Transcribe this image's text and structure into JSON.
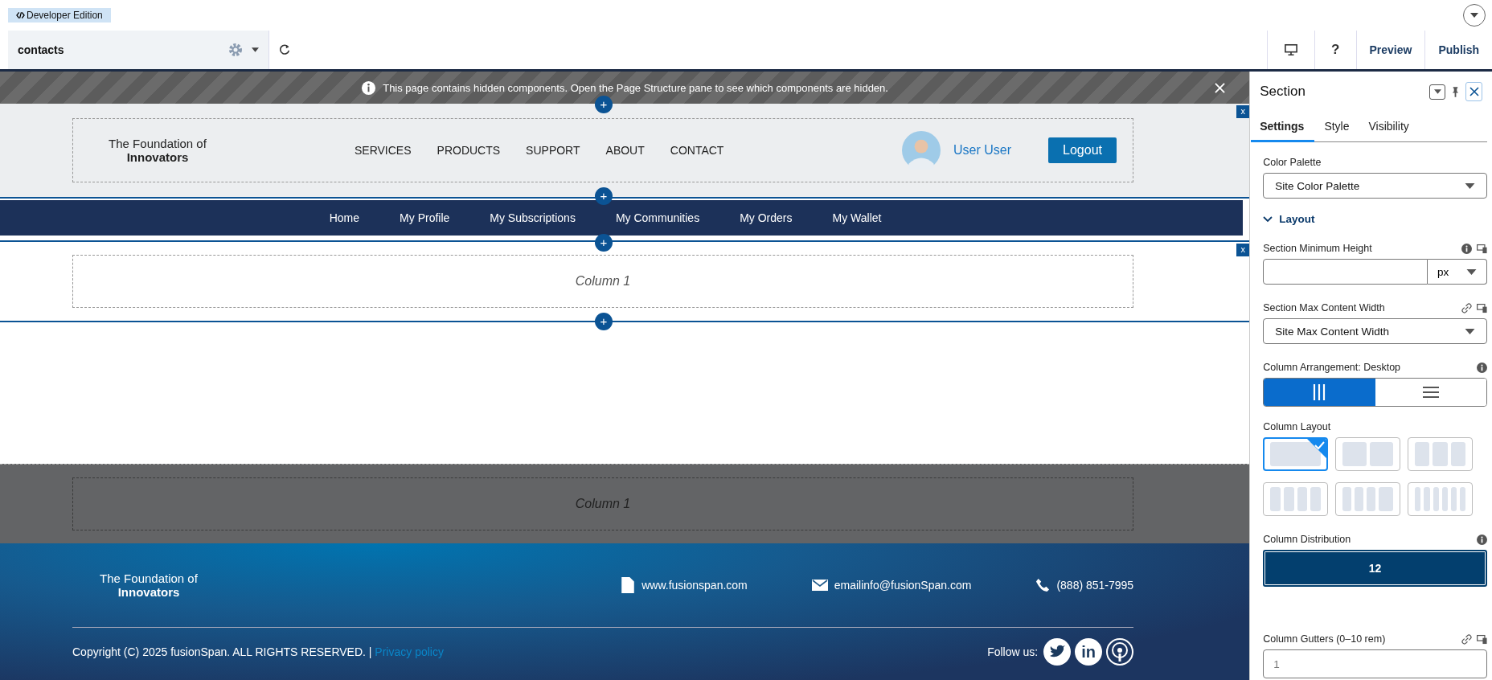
{
  "top_bar": {
    "edition_badge": "Developer Edition"
  },
  "toolbar": {
    "page_name": "contacts",
    "right_buttons": [
      {
        "kind": "device"
      },
      {
        "kind": "help",
        "label": "?"
      },
      {
        "kind": "text",
        "label": "Preview"
      },
      {
        "kind": "text",
        "label": "Publish"
      }
    ]
  },
  "notice": {
    "text": "This page contains hidden components. Open the Page Structure pane to see which components are hidden."
  },
  "site_header": {
    "add_mark": "+",
    "remove_mark": "x",
    "logo_line_1": "The Foundation of",
    "logo_line_2": "Innovators",
    "menu": [
      "SERVICES",
      "PRODUCTS",
      "SUPPORT",
      "ABOUT",
      "CONTACT"
    ],
    "user_name": "User User",
    "logout": "Logout"
  },
  "nav_bar": {
    "add_mark": "+",
    "links": [
      "Home",
      "My Profile",
      "My Subscriptions",
      "My Communities",
      "My Orders",
      "My Wallet"
    ]
  },
  "sections": [
    {
      "column": "Column 1",
      "hidden": false,
      "add_mark_top": "+",
      "remove_mark": "x",
      "add_mark_bottom": "+"
    },
    {
      "column": "Column 1",
      "hidden": true
    }
  ],
  "footer": {
    "logo_line_1": "The Foundation of",
    "logo_line_2": "Innovators",
    "contacts": [
      {
        "kind": "file",
        "text": "www.fusionspan.com"
      },
      {
        "kind": "mail",
        "text": "emailinfo@fusionSpan.com"
      },
      {
        "kind": "phone",
        "text": "(888) 851-7995"
      }
    ],
    "copyright": "Copyright (C) 2025 fusionSpan. ALL RIGHTS RESERVED. |",
    "privacy_link": "Privacy policy",
    "follow_label": "Follow us:",
    "social": [
      {
        "kind": "bird"
      },
      {
        "kind": "text",
        "label": "in"
      },
      {
        "kind": "podcast"
      }
    ]
  },
  "panel": {
    "title": "Section",
    "tabs": [
      {
        "label": "Settings",
        "selected": true
      },
      {
        "label": "Style",
        "selected": false
      },
      {
        "label": "Visibility",
        "selected": false
      }
    ],
    "color_palette": {
      "label": "Color Palette",
      "value": "Site Color Palette"
    },
    "layout_heading": {
      "label": "Layout",
      "expanded": true
    },
    "min_height": {
      "label": "Section Minimum Height",
      "unit": "px"
    },
    "max_width": {
      "label": "Section Max Content Width",
      "value": "Site Max Content Width"
    },
    "arrangement": {
      "label": "Column Arrangement: Desktop",
      "options": [
        {
          "kind": "columns",
          "selected": true
        },
        {
          "kind": "rows",
          "selected": false
        }
      ]
    },
    "column_layout": {
      "label": "Column Layout",
      "options": [
        {
          "kind": "one",
          "selected": true
        },
        {
          "kind": "two",
          "selected": false
        },
        {
          "kind": "three",
          "selected": false
        },
        {
          "kind": "four",
          "selected": false
        },
        {
          "kind": "narrow-wide",
          "selected": false
        },
        {
          "kind": "six",
          "selected": false
        }
      ]
    },
    "distribution": {
      "label": "Column Distribution",
      "value": "12"
    },
    "gutters": {
      "label": "Column Gutters (0–10 rem)",
      "placeholder": "1"
    }
  }
}
